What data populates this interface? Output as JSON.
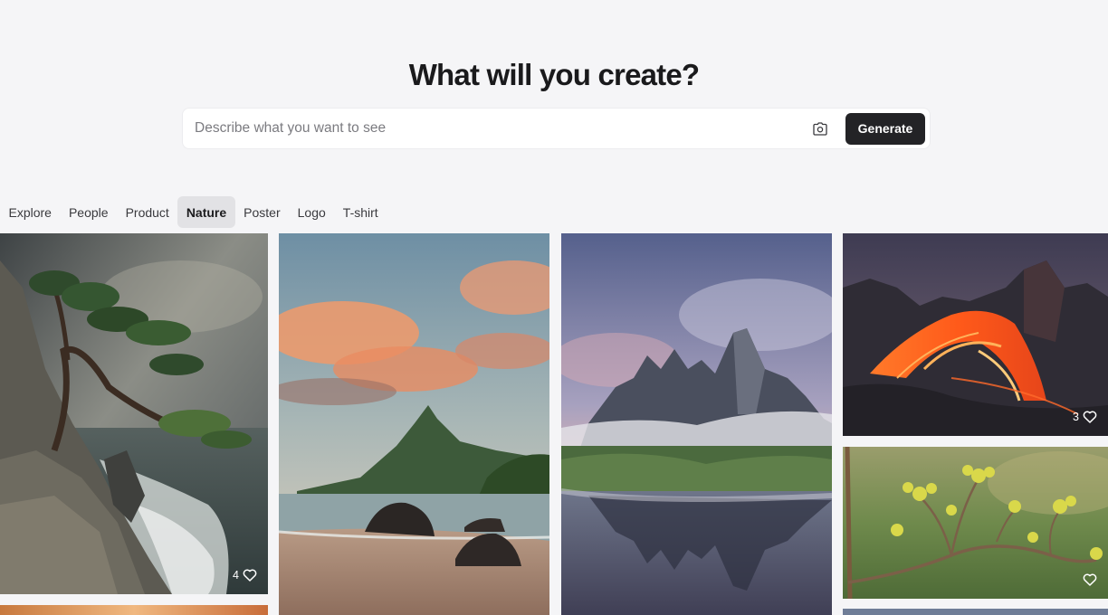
{
  "hero": {
    "title": "What will you create?"
  },
  "search": {
    "placeholder": "Describe what you want to see",
    "value": "",
    "camera_icon": "camera-icon",
    "generate_label": "Generate"
  },
  "tabs": [
    {
      "label": "Explore",
      "active": false
    },
    {
      "label": "People",
      "active": false
    },
    {
      "label": "Product",
      "active": false
    },
    {
      "label": "Nature",
      "active": true
    },
    {
      "label": "Poster",
      "active": false
    },
    {
      "label": "Logo",
      "active": false
    },
    {
      "label": "T-shirt",
      "active": false
    }
  ],
  "gallery": [
    {
      "subject": "cliff-pine-ocean",
      "likes": "4",
      "like_icon": "heart-icon"
    },
    {
      "subject": "tropical-beach-sunset",
      "likes": "",
      "like_icon": ""
    },
    {
      "subject": "mountain-lake-reflection",
      "likes": "",
      "like_icon": ""
    },
    {
      "subject": "lava-flow",
      "likes": "3",
      "like_icon": "heart-icon"
    },
    {
      "subject": "budding-branch",
      "likes": "",
      "like_icon": "heart-icon"
    }
  ],
  "colors": {
    "background": "#f5f5f7",
    "button": "#232326",
    "active_tab": "#e2e2e5"
  }
}
